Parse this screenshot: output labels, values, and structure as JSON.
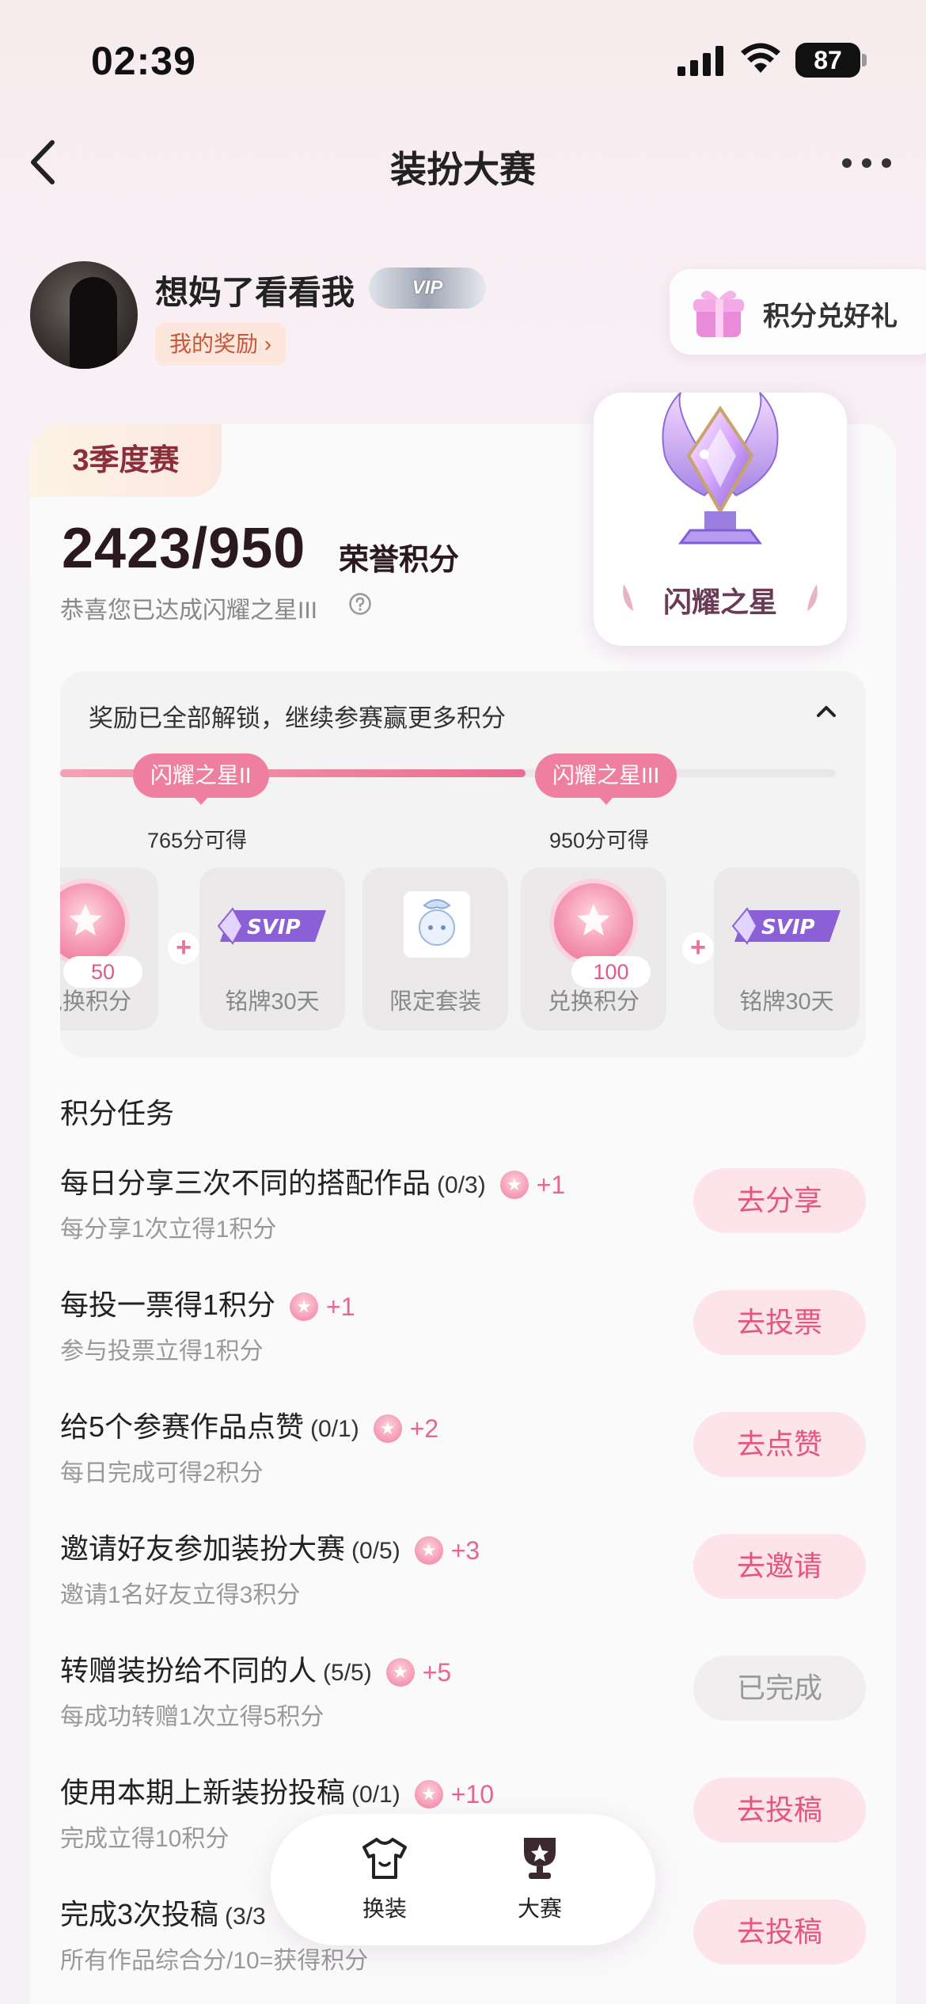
{
  "status_bar": {
    "time": "02:39",
    "battery": "87"
  },
  "header": {
    "title": "装扮大赛"
  },
  "user": {
    "name": "想妈了看看我",
    "vip_label": "VIP",
    "reward_label": "我的奖励 ›",
    "gift_label": "积分兑好礼"
  },
  "season": {
    "tag": "3季度赛",
    "score": "2423/950",
    "unit": "荣誉积分",
    "congrats": "恭喜您已达成闪耀之星III",
    "trophy_label": "闪耀之星"
  },
  "rewards": {
    "title": "奖励已全部解锁，继续参赛赢更多积分",
    "progress": 0.6,
    "milestones": [
      {
        "label": "闪耀之星II",
        "note": "765分可得"
      },
      {
        "label": "闪耀之星III",
        "note": "950分可得"
      }
    ],
    "items": [
      {
        "label": "兑换积分",
        "value": "50"
      },
      {
        "label": "铭牌30天",
        "badge": "SVIP"
      },
      {
        "label": "限定套装"
      },
      {
        "label": "兑换积分",
        "value": "100"
      },
      {
        "label": "铭牌30天",
        "badge": "SVIP"
      }
    ],
    "plus": "+"
  },
  "tasks": {
    "title": "积分任务",
    "list": [
      {
        "name": "每日分享三次不同的搭配作品",
        "progress": "(0/3)",
        "points": "+1",
        "desc": "每分享1次立得1积分",
        "button": "去分享"
      },
      {
        "name": "每投一票得1积分",
        "progress": "",
        "points": "+1",
        "desc": "参与投票立得1积分",
        "button": "去投票"
      },
      {
        "name": "给5个参赛作品点赞",
        "progress": "(0/1)",
        "points": "+2",
        "desc": "每日完成可得2积分",
        "button": "去点赞"
      },
      {
        "name": "邀请好友参加装扮大赛",
        "progress": "(0/5)",
        "points": "+3",
        "desc": "邀请1名好友立得3积分",
        "button": "去邀请"
      },
      {
        "name": "转赠装扮给不同的人",
        "progress": "(5/5)",
        "points": "+5",
        "desc": "每成功转赠1次立得5积分",
        "button": "已完成"
      },
      {
        "name": "使用本期上新装扮投稿",
        "progress": "(0/1)",
        "points": "+10",
        "desc": "完成立得10积分",
        "button": "去投稿"
      },
      {
        "name": "完成3次投稿",
        "progress": "(3/3",
        "points": "",
        "desc": "所有作品综合分/10=获得积分",
        "button": "去投稿"
      }
    ]
  },
  "nav": {
    "items": [
      {
        "label": "换装"
      },
      {
        "label": "大赛"
      }
    ]
  }
}
